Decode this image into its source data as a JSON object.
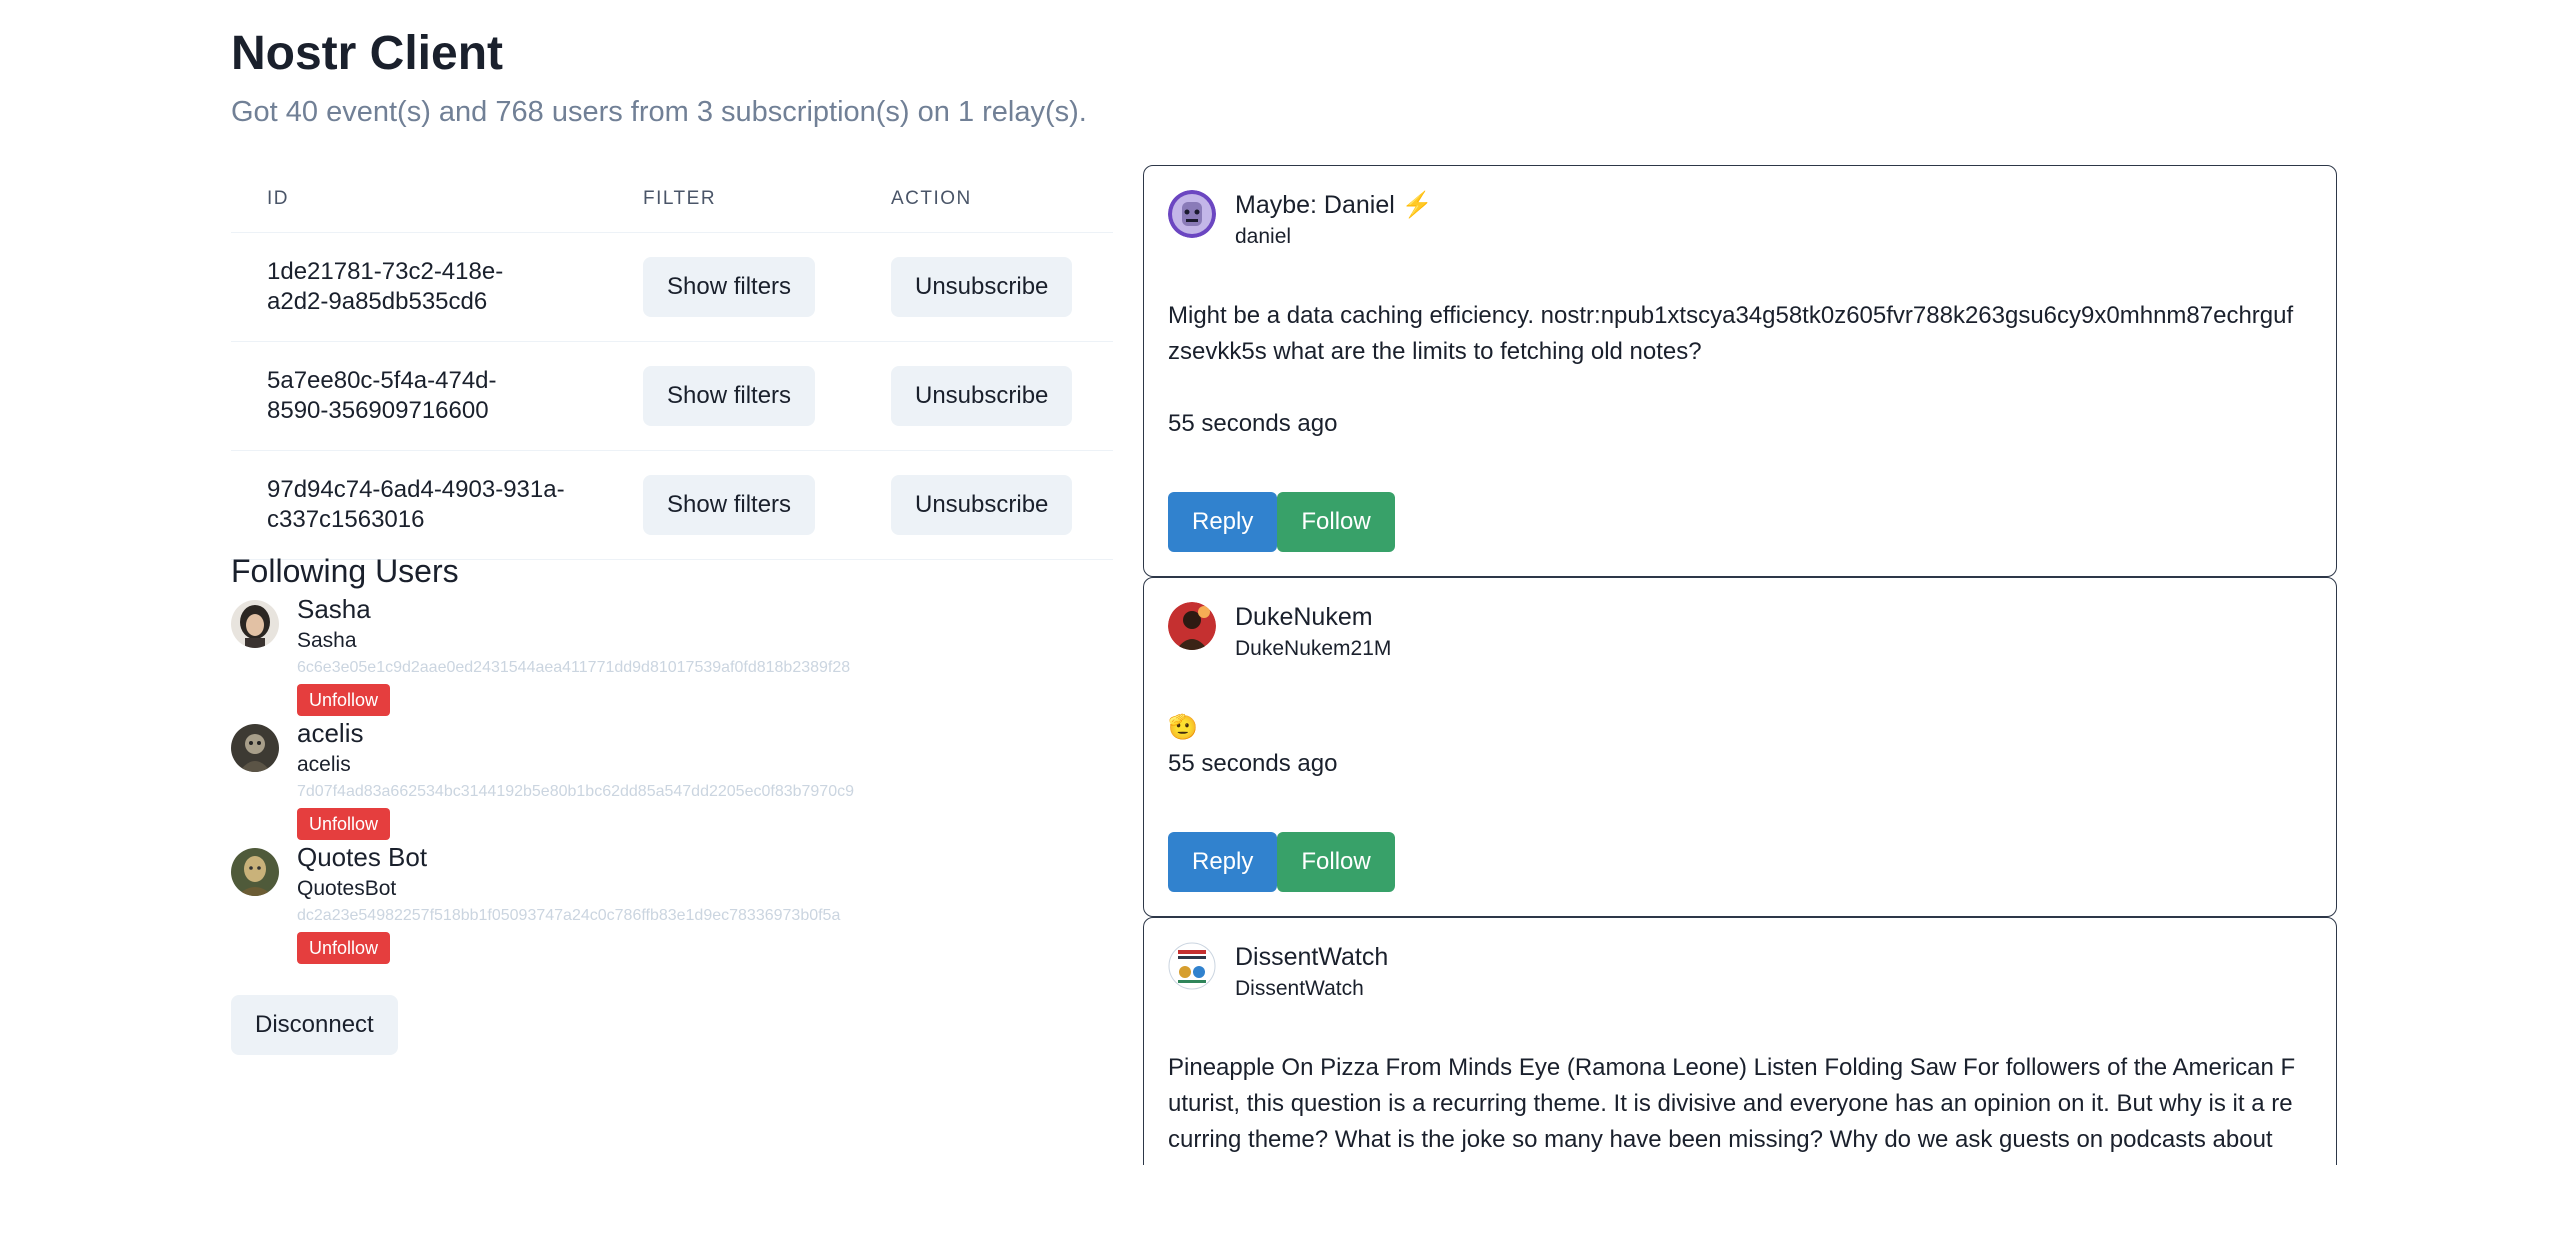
{
  "header": {
    "title": "Nostr Client",
    "subtitle": "Got 40 event(s) and 768 users from 3 subscription(s) on 1 relay(s)."
  },
  "subscriptions": {
    "columns": [
      "ID",
      "FILTER",
      "ACTION"
    ],
    "rows": [
      {
        "id_line1": "1de21781-73c2-418e-",
        "id_line2": "a2d2-9a85db535cd6",
        "filter_label": "Show filters",
        "action_label": "Unsubscribe"
      },
      {
        "id_line1": "5a7ee80c-5f4a-474d-",
        "id_line2": "8590-356909716600",
        "filter_label": "Show filters",
        "action_label": "Unsubscribe"
      },
      {
        "id_line1": "97d94c74-6ad4-4903-931a-",
        "id_line2": "c337c1563016",
        "filter_label": "Show filters",
        "action_label": "Unsubscribe"
      }
    ]
  },
  "following": {
    "heading": "Following Users",
    "unfollow_label": "Unfollow",
    "users": [
      {
        "name": "Sasha",
        "username": "Sasha",
        "pubkey": "6c6e3e05e1c9d2aae0ed2431544aea411771dd9d81017539af0fd818b2389f28"
      },
      {
        "name": "acelis",
        "username": "acelis",
        "pubkey": "7d07f4ad83a662534bc3144192b5e80b1bc62dd85a547dd2205ec0f83b7970c9"
      },
      {
        "name": "Quotes Bot",
        "username": "QuotesBot",
        "pubkey": "dc2a23e54982257f518bb1f05093747a24c0c786ffb83e1d9ec78336973b0f5a"
      }
    ]
  },
  "disconnect_label": "Disconnect",
  "feed": {
    "reply_label": "Reply",
    "follow_label": "Follow",
    "posts": [
      {
        "author": "Maybe: Daniel",
        "badge": "⚡",
        "handle": "daniel",
        "content": "Might be a data caching efficiency. nostr:npub1xtscya34g58tk0z605fvr788k263gsu6cy9x0mhnm87echrgufzsevkk5s what are the limits to fetching old notes?",
        "time": "55 seconds ago"
      },
      {
        "author": "DukeNukem",
        "handle": "DukeNukem21M",
        "content": "🫡",
        "time": "55 seconds ago"
      },
      {
        "author": "DissentWatch",
        "handle": "DissentWatch",
        "content": "Pineapple On Pizza From Minds Eye (Ramona Leone) Listen Folding Saw For followers of the American Futurist, this question is a recurring theme. It is divisive and everyone has an opinion on it. But why is it a recurring theme? What is the joke so many have been missing? Why do we ask guests on podcasts about"
      }
    ]
  }
}
